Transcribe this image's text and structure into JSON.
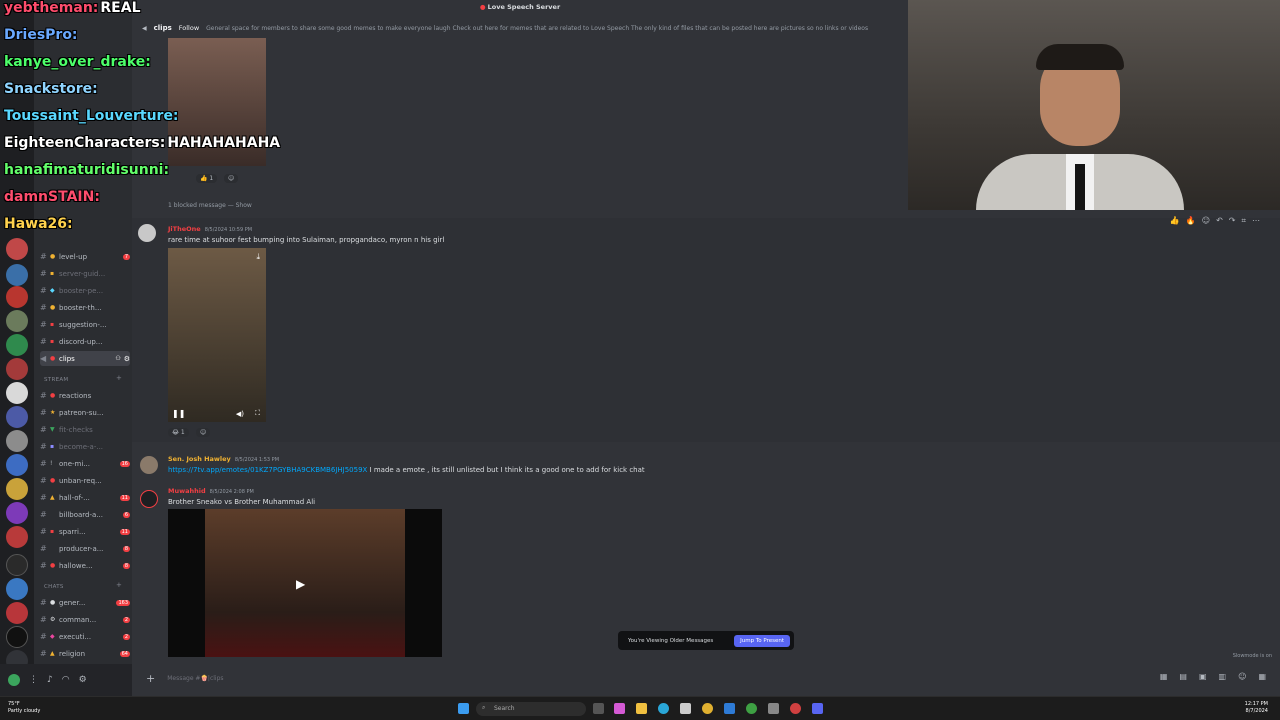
{
  "server_name": "Love Speech Server",
  "channel": {
    "name": "clips",
    "follow_label": "Follow",
    "topic": "General space for members to share some good memes to make everyone laugh Check out here for memes that are related to Love Speech The only kind of files that can be posted here are pictures so no links or videos"
  },
  "sidebar": {
    "channels": [
      {
        "label": "level-up",
        "count": "7"
      },
      {
        "label": "server-guid...",
        "count": ""
      },
      {
        "label": "booster-pe...",
        "count": ""
      },
      {
        "label": "booster-th...",
        "count": ""
      },
      {
        "label": "suggestion-...",
        "count": ""
      },
      {
        "label": "discord-up...",
        "count": ""
      },
      {
        "label": "clips",
        "count": ""
      }
    ],
    "stream_category": "STREAM",
    "stream_channels": [
      {
        "label": "reactions",
        "count": ""
      },
      {
        "label": "patreon-su...",
        "count": ""
      },
      {
        "label": "fit-checks",
        "count": ""
      },
      {
        "label": "become-a-...",
        "count": ""
      },
      {
        "label": "one-mi...",
        "count": "16"
      },
      {
        "label": "unban-req...",
        "count": ""
      },
      {
        "label": "hall-of-...",
        "count": "11"
      },
      {
        "label": "billboard-a...",
        "count": "6"
      },
      {
        "label": "sparri...",
        "count": "11"
      },
      {
        "label": "producer-a...",
        "count": "8"
      },
      {
        "label": "hallowe...",
        "count": "8"
      }
    ],
    "chats_category": "CHATS",
    "chats_channels": [
      {
        "label": "gener...",
        "count": "163"
      },
      {
        "label": "comman...",
        "count": "2"
      },
      {
        "label": "executi...",
        "count": "2"
      },
      {
        "label": "religion",
        "count": "64"
      }
    ]
  },
  "messages": {
    "blocked": "1 blocked message — Show",
    "top_reaction": "1",
    "m1_author": "JiTheOne",
    "m1_time": "8/5/2024 10:59 PM",
    "m1_text": "rare time at suhoor fest bumping into Sulaiman, propgandaco, myron n his girl",
    "m1_reaction": "1",
    "m2_author": "Sen. Josh Hawley",
    "m2_time": "8/5/2024 1:53 PM",
    "m2_link": "https://7tv.app/emotes/01KZ7PGYBHA9CKBMB6JHJ5059X",
    "m2_text": " I made a emote , its still unlisted but I think its a good one to add for kick chat",
    "m3_author": "Muwahhid",
    "m3_time": "8/5/2024 2:08 PM",
    "m3_text": "Brother Sneako vs Brother Muhammad Ali"
  },
  "older_bar": {
    "text": "You're Viewing Older Messages",
    "jump_label": "Jump To Present"
  },
  "composer": {
    "placeholder": "Message #🍿|clips"
  },
  "slowmode": "Slowmode is on",
  "twitch_chat": [
    {
      "name": "yebtheman:",
      "msg": "REAL",
      "color": "#ff4d6d"
    },
    {
      "name": "DriesPro:",
      "msg": "",
      "color": "#6aa9ff"
    },
    {
      "name": "kanye_over_drake:",
      "msg": "",
      "color": "#4dff6a"
    },
    {
      "name": "Snackstore:",
      "msg": "",
      "color": "#8fd4ff"
    },
    {
      "name": "Toussaint_Louverture:",
      "msg": "",
      "color": "#5ad8ff"
    },
    {
      "name": "EighteenCharacters:",
      "msg": "HAHAHAHAHA",
      "color": "#ffffff"
    },
    {
      "name": "hanafimaturidisunni:",
      "msg": "",
      "color": "#63ff6b"
    },
    {
      "name": "damnSTAIN:",
      "msg": "",
      "color": "#ff4d6d"
    },
    {
      "name": "Hawa26:",
      "msg": "",
      "color": "#ffd24d"
    }
  ],
  "taskbar": {
    "weather_temp": "75°F",
    "weather_desc": "Partly cloudy",
    "search": "Search",
    "time": "12:17 PM",
    "date": "8/7/2024"
  },
  "colors": {
    "accent": "#5865f2",
    "mention_red": "#f23f43",
    "author_orange": "#f0b232",
    "author_red": "#f23f43"
  }
}
